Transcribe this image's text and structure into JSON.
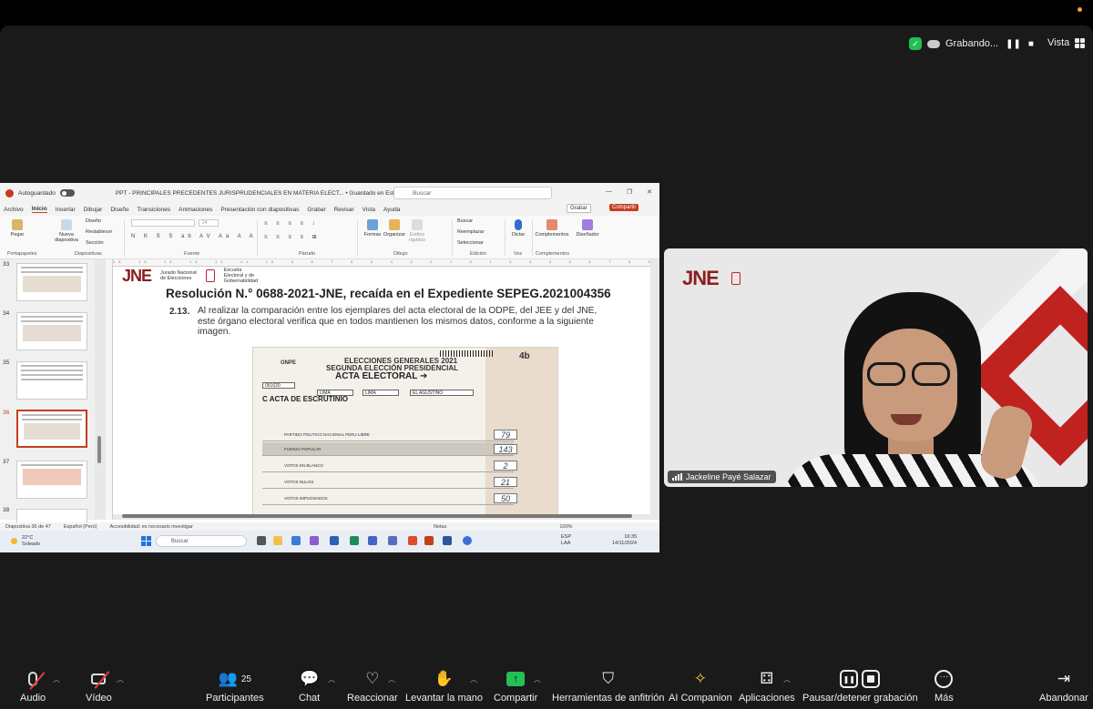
{
  "meeting": {
    "recording_label": "Grabando...",
    "view_label": "Vista",
    "participant_count": "25",
    "participant_name": "Jackeline Payé Salazar"
  },
  "powerpoint": {
    "autosave_label": "Autoguardado",
    "file_title": "PPT - PRINCIPALES PRECEDENTES JURISPRUDENCIALES EN MATERIA ELECT... • Guardado en Este PC",
    "search_placeholder": "Buscar",
    "menu": [
      "Archivo",
      "Inicio",
      "Insertar",
      "Dibujar",
      "Diseño",
      "Transiciones",
      "Animaciones",
      "Presentación con diapositivas",
      "Grabar",
      "Revisar",
      "Vista",
      "Ayuda"
    ],
    "grabar_btn": "Grabar",
    "compartir_btn": "Compartir",
    "ribbon": {
      "pegar": "Pegar",
      "nueva_diapositiva": "Nueva diapositiva",
      "diseno": "Diseño",
      "restablecer": "Restablecer",
      "seccion": "Sección",
      "formas": "Formas",
      "organizar": "Organizar",
      "estilos": "Estilos rápidos",
      "buscar": "Buscar",
      "reemplazar": "Reemplazar",
      "seleccionar": "Seleccionar",
      "dictar": "Dictar",
      "complementos": "Complementos",
      "disenador": "Diseñador",
      "font_size": "24",
      "groups": {
        "portapapeles": "Portapapeles",
        "diapositivas": "Diapositivas",
        "fuente": "Fuente",
        "parrafo": "Párrafo",
        "dibujo": "Dibujo",
        "edicion": "Edición",
        "voz": "Voz",
        "complementos": "Complementos"
      }
    },
    "slide_numbers": [
      "33",
      "34",
      "35",
      "36",
      "37",
      "38"
    ],
    "selected_slide": "36",
    "status": {
      "slide_info": "Diapositiva 36 de 47",
      "language": "Español (Perú)",
      "accessibility": "Accesibilidad: es necesario investigar",
      "notes": "Notas",
      "zoom": "100%"
    },
    "ruler_text": "16 · 15 · 14 · 13 · 12 · 11 · 10 · 9 · 8 · 7 · 6 · 5 · 4 · 3 · 2 · 1 · 0 · 1 · 2 · 3 · 4 · 5 · 6 · 7 · 8 · 9 · 10 · 11 · 12 · 13 · 14 · 15 · 16"
  },
  "slide": {
    "logo": "JNE",
    "logo_sub1": "Jurado Nacional",
    "logo_sub2": "de Elecciones",
    "escuela_sub1": "Escuela",
    "escuela_sub2": "Electoral y de",
    "escuela_sub3": "Gobernabilidad",
    "title": "Resolución N.° 0688-2021-JNE, recaída en el Expediente SEPEG.2021004356",
    "para_number": "2.13.",
    "para_text": "Al realizar la comparación entre los ejemplares del acta electoral de la ODPE, del JEE y del JNE, este órgano electoral verifica que en todos mantienen los mismos datos, conforme a la siguiente imagen.",
    "acta": {
      "onpe": "ONPE",
      "h1": "ELECCIONES GENERALES 2021",
      "h2": "SEGUNDA ELECCIÓN PRESIDENCIAL",
      "h3": "ACTA ELECTORAL ➔",
      "code": "4b",
      "mesa": "051020",
      "dept": "LIMA",
      "prov": "LIMA",
      "dist": "EL AGUSTINO",
      "section": "C  ACTA DE ESCRUTINIO",
      "rows": [
        {
          "label": "PARTIDO POLITICO NACIONAL PERU LIBRE",
          "value": "79"
        },
        {
          "label": "FUERZA POPULAR",
          "value": "143"
        },
        {
          "label": "VOTOS EN BLANCO",
          "value": "2"
        },
        {
          "label": "VOTOS NULOS",
          "value": "21"
        },
        {
          "label": "VOTOS IMPUGNADOS",
          "value": "50"
        }
      ]
    }
  },
  "taskbar": {
    "temp": "22°C",
    "weather": "Soleado",
    "search": "Buscar",
    "lang1": "ESP",
    "lang2": "LAA",
    "time": "16:35",
    "date": "14/11/2024"
  },
  "toolbar": {
    "audio": "Audio",
    "video": "Vídeo",
    "participants": "Participantes",
    "chat": "Chat",
    "react": "Reaccionar",
    "raise_hand": "Levantar la mano",
    "share": "Compartir",
    "host_tools": "Herramientas de anfitrión",
    "ai_companion": "AI Companion",
    "apps": "Aplicaciones",
    "pause_record": "Pausar/detener grabación",
    "more": "Más",
    "leave": "Abandonar"
  }
}
